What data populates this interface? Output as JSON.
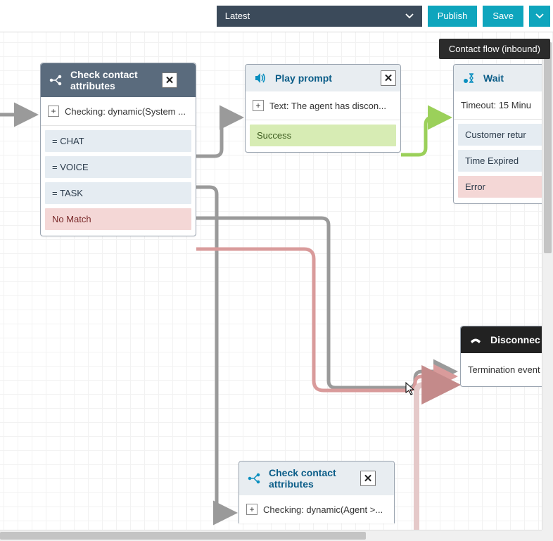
{
  "toolbar": {
    "dropdown_label": "Latest",
    "publish_label": "Publish",
    "save_label": "Save"
  },
  "badge": {
    "label": "Contact flow (inbound)"
  },
  "nodes": {
    "check1": {
      "title": "Check contact attributes",
      "detail": "Checking: dynamic(System ...",
      "branches": {
        "chat": "= CHAT",
        "voice": "= VOICE",
        "task": "= TASK",
        "nomatch": "No Match"
      }
    },
    "play": {
      "title": "Play prompt",
      "detail": "Text: The agent has discon...",
      "success": "Success"
    },
    "wait": {
      "title": "Wait",
      "detail": "Timeout: 15 Minu",
      "branches": {
        "customer": "Customer retur",
        "expired": "Time Expired",
        "error": "Error"
      }
    },
    "disconnect": {
      "title": "Disconnec",
      "detail": "Termination event"
    },
    "check2": {
      "title": "Check contact attributes",
      "detail": "Checking: dynamic(Agent >..."
    }
  },
  "icons": {
    "close": "✕",
    "expand": "+"
  }
}
